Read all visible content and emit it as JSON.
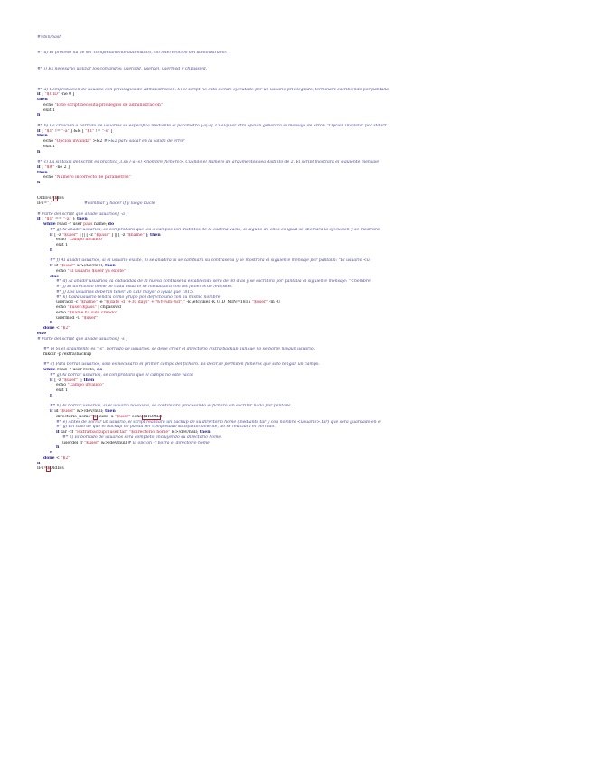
{
  "lines": [
    {
      "i": 0,
      "segs": [
        {
          "c": "cm",
          "t": "#!/bin/bash"
        }
      ]
    },
    {
      "i": 0,
      "segs": []
    },
    {
      "i": 0,
      "segs": []
    },
    {
      "i": 0,
      "segs": [
        {
          "c": "cm",
          "t": "#* a) El proceso ha de ser completamente automático, sin intervención del administrador."
        }
      ]
    },
    {
      "i": 0,
      "segs": []
    },
    {
      "i": 0,
      "segs": []
    },
    {
      "i": 0,
      "segs": [
        {
          "c": "cm",
          "t": "#* i) Es necesario utilizar los comandos: useradd, userdel, usermod y chpasswd."
        }
      ]
    },
    {
      "i": 0,
      "segs": []
    },
    {
      "i": 0,
      "segs": []
    },
    {
      "i": 0,
      "segs": []
    },
    {
      "i": 0,
      "segs": [
        {
          "c": "cm",
          "t": "#* a) Comprobación de usuario con privilegios de administración. Si el script no está siendo ejecutado por un usuario privilegiado, terminará escribiendo por pantalla"
        }
      ]
    },
    {
      "i": 0,
      "segs": [
        {
          "c": "kw",
          "t": "if"
        },
        {
          "c": "pl",
          "t": " [ "
        },
        {
          "c": "st",
          "t": "\"$UID\""
        },
        {
          "c": "pl",
          "t": " -ne 0 ]"
        }
      ]
    },
    {
      "i": 0,
      "segs": [
        {
          "c": "kw",
          "t": "then"
        }
      ]
    },
    {
      "i": 1,
      "segs": [
        {
          "c": "pl",
          "t": "echo "
        },
        {
          "c": "st",
          "t": "\"Este script necesita privilegios de administracion\""
        }
      ]
    },
    {
      "i": 1,
      "segs": [
        {
          "c": "pl",
          "t": "exit 1"
        }
      ]
    },
    {
      "i": 0,
      "segs": [
        {
          "c": "kw",
          "t": "fi"
        }
      ]
    },
    {
      "i": 0,
      "segs": []
    },
    {
      "i": 0,
      "segs": [
        {
          "c": "cm",
          "t": "#* b) La creación o borrado de usuarios se especifica mediante el parámetro [-a|-s]. Cualquier otra opción generará el mensaje de error: \"Opcion invalida\" por stderr"
        }
      ]
    },
    {
      "i": 0,
      "segs": [
        {
          "c": "kw",
          "t": "if"
        },
        {
          "c": "pl",
          "t": " [ "
        },
        {
          "c": "st",
          "t": "\"$1\""
        },
        {
          "c": "pl",
          "t": " != "
        },
        {
          "c": "st",
          "t": "\"-a\""
        },
        {
          "c": "pl",
          "t": " ] && [ "
        },
        {
          "c": "st",
          "t": "\"$1\""
        },
        {
          "c": "pl",
          "t": " != "
        },
        {
          "c": "st",
          "t": "\"-s\""
        },
        {
          "c": "pl",
          "t": " ]"
        }
      ]
    },
    {
      "i": 0,
      "segs": [
        {
          "c": "kw",
          "t": "then"
        }
      ]
    },
    {
      "i": 1,
      "segs": [
        {
          "c": "pl",
          "t": "echo "
        },
        {
          "c": "st",
          "t": "\"Opcion invalida\""
        },
        {
          "c": "pl",
          "t": " >&2 "
        },
        {
          "c": "cm",
          "t": "#>&2 para sacar en la salida de error"
        }
      ]
    },
    {
      "i": 1,
      "segs": [
        {
          "c": "pl",
          "t": "exit 1"
        }
      ]
    },
    {
      "i": 0,
      "segs": [
        {
          "c": "kw",
          "t": "fi"
        }
      ]
    },
    {
      "i": 0,
      "segs": []
    },
    {
      "i": 0,
      "segs": [
        {
          "c": "cm",
          "t": "#* c) La sintaxis del script es practica_3.sh [-a|-s] <nombre_fichero>. Cuando el número de argumentos sea distinto de 2. El script mostrará el siguiente mensaje"
        }
      ]
    },
    {
      "i": 0,
      "segs": [
        {
          "c": "kw",
          "t": "if"
        },
        {
          "c": "pl",
          "t": " [ "
        },
        {
          "c": "st",
          "t": "\"$#\""
        },
        {
          "c": "pl",
          "t": " -ne 2 ]"
        }
      ]
    },
    {
      "i": 0,
      "segs": [
        {
          "c": "kw",
          "t": "then"
        }
      ]
    },
    {
      "i": 1,
      "segs": [
        {
          "c": "pl",
          "t": "echo "
        },
        {
          "c": "st",
          "t": "\"Numero incorrecto de parametros\""
        }
      ]
    },
    {
      "i": 0,
      "segs": [
        {
          "c": "kw",
          "t": "fi"
        }
      ]
    },
    {
      "i": 0,
      "segs": []
    },
    {
      "i": 0,
      "segs": []
    },
    {
      "i": 0,
      "segs": [
        {
          "c": "pl",
          "t": "OldIFs="
        },
        {
          "c": "pl box",
          "t": "$"
        },
        {
          "c": "pl",
          "t": "IFs"
        }
      ]
    },
    {
      "i": 0,
      "segs": [
        {
          "c": "pl",
          "t": "IFs="
        },
        {
          "c": "st",
          "t": "\",\""
        },
        {
          "c": "pl",
          "t": "                        "
        },
        {
          "c": "cm",
          "t": "#cambiar y hacer if y luego bucle"
        }
      ]
    },
    {
      "i": 0,
      "segs": []
    },
    {
      "i": 0,
      "segs": [
        {
          "c": "cm",
          "t": "# Parte del script que añade usuarios [ -a ]"
        }
      ]
    },
    {
      "i": 0,
      "segs": [
        {
          "c": "kw",
          "t": "if"
        },
        {
          "c": "pl",
          "t": " [ "
        },
        {
          "c": "st",
          "t": "\"$1\""
        },
        {
          "c": "pl",
          "t": " == "
        },
        {
          "c": "st",
          "t": "\"-a\""
        },
        {
          "c": "pl",
          "t": " ]; "
        },
        {
          "c": "kw",
          "t": "then"
        }
      ]
    },
    {
      "i": 1,
      "segs": [
        {
          "c": "kw",
          "t": "while"
        },
        {
          "c": "pl",
          "t": " read -r user "
        },
        {
          "c": "st",
          "t": "pass"
        },
        {
          "c": "pl",
          "t": " name; "
        },
        {
          "c": "kw",
          "t": "do"
        }
      ]
    },
    {
      "i": 2,
      "segs": [
        {
          "c": "cm",
          "t": "#* g) Al añadir usuarios, se comprobará que los 3 campos son distintos de la cadena vacía, si alguno de ellos es igual se abortará la ejecución y se mostrará"
        }
      ]
    },
    {
      "i": 2,
      "segs": [
        {
          "c": "kw",
          "t": "if"
        },
        {
          "c": "pl",
          "t": " [ -z "
        },
        {
          "c": "st",
          "t": "\"$user\""
        },
        {
          "c": "pl",
          "t": " ] || [ -z "
        },
        {
          "c": "st",
          "t": "\"$pass\""
        },
        {
          "c": "pl",
          "t": " ] || [ -z "
        },
        {
          "c": "st",
          "t": "\"$name\""
        },
        {
          "c": "pl",
          "t": " ]; "
        },
        {
          "c": "kw",
          "t": "then"
        }
      ]
    },
    {
      "i": 3,
      "segs": [
        {
          "c": "pl",
          "t": "echo "
        },
        {
          "c": "st",
          "t": "\"Campo invalido\""
        }
      ]
    },
    {
      "i": 3,
      "segs": [
        {
          "c": "pl",
          "t": "exit 1"
        }
      ]
    },
    {
      "i": 2,
      "segs": [
        {
          "c": "kw",
          "t": "fi"
        }
      ]
    },
    {
      "i": 0,
      "segs": []
    },
    {
      "i": 2,
      "segs": [
        {
          "c": "cm",
          "t": "#* f) Al añadir usuarios, si el usuario existe, ni se añadirá ni se cambiará su contraseña y se mostrará el siguiente mensaje por pantalla: \"El usuario <u"
        }
      ]
    },
    {
      "i": 2,
      "segs": [
        {
          "c": "kw",
          "t": "if"
        },
        {
          "c": "pl",
          "t": " id "
        },
        {
          "c": "st",
          "t": "\"$user\""
        },
        {
          "c": "pl",
          "t": " &>/dev/null; "
        },
        {
          "c": "kw",
          "t": "then"
        }
      ]
    },
    {
      "i": 3,
      "segs": [
        {
          "c": "pl",
          "t": "echo "
        },
        {
          "c": "st",
          "t": "\"El usuario $user ya existe\""
        }
      ]
    },
    {
      "i": 2,
      "segs": [
        {
          "c": "kw",
          "t": "else"
        }
      ]
    },
    {
      "i": 3,
      "segs": [
        {
          "c": "cm",
          "t": "#* d) Al añadir usuarios, la caducidad de la nueva contraseña establecida será de 30 días y se escribirá por pantalla el siguiente mensaje: \"<nombre"
        }
      ]
    },
    {
      "i": 3,
      "segs": [
        {
          "c": "cm",
          "t": "#* j) El directorio home de cada usuario se inicializará con los ficheros de /etc/skel."
        }
      ]
    },
    {
      "i": 3,
      "segs": [
        {
          "c": "cm",
          "t": "#* j) Los usuarios deberán tener un UID mayor o igual que 1815."
        }
      ]
    },
    {
      "i": 3,
      "segs": [
        {
          "c": "cm",
          "t": "#* k) Cada usuario tendrá como grupo por defecto uno con su mismo nombre"
        }
      ]
    },
    {
      "i": 3,
      "segs": [
        {
          "c": "pl",
          "t": "useradd -c "
        },
        {
          "c": "st",
          "t": "\"$name\""
        },
        {
          "c": "pl",
          "t": " -e "
        },
        {
          "c": "st",
          "t": "\"$(date -d \"+30 days\" +\"%Y-%m-%d\")\""
        },
        {
          "c": "pl",
          "t": " -k /etc/skel -K UID_MIN=1815 "
        },
        {
          "c": "st",
          "t": "\"$user\""
        },
        {
          "c": "pl",
          "t": " -m -U"
        }
      ]
    },
    {
      "i": 3,
      "segs": [
        {
          "c": "pl",
          "t": "echo "
        },
        {
          "c": "st",
          "t": "\"$user:$pass\""
        },
        {
          "c": "pl",
          "t": " | chpasswd"
        }
      ]
    },
    {
      "i": 3,
      "segs": [
        {
          "c": "pl",
          "t": "echo "
        },
        {
          "c": "st",
          "t": "\"$name ha sido creado\""
        }
      ]
    },
    {
      "i": 3,
      "segs": [
        {
          "c": "pl",
          "t": "usermod -U "
        },
        {
          "c": "st",
          "t": "\"$user\""
        }
      ]
    },
    {
      "i": 2,
      "segs": [
        {
          "c": "kw",
          "t": "fi"
        }
      ]
    },
    {
      "i": 1,
      "segs": [
        {
          "c": "kw",
          "t": "done"
        },
        {
          "c": "pl",
          "t": " < "
        },
        {
          "c": "st",
          "t": "\"$2\""
        }
      ]
    },
    {
      "i": 0,
      "segs": [
        {
          "c": "kw",
          "t": "else"
        }
      ]
    },
    {
      "i": 0,
      "segs": [
        {
          "c": "cm",
          "t": "# Parte del script que añade usuarios [ -s ]"
        }
      ]
    },
    {
      "i": 0,
      "segs": []
    },
    {
      "i": 1,
      "segs": [
        {
          "c": "cm",
          "t": "#* p) Si el argumento es \"-s\", borrado de usuarios, se debe crear el directorio /extra/backup aunque no se borre ningún usuario."
        }
      ]
    },
    {
      "i": 1,
      "segs": [
        {
          "c": "pl",
          "t": "mkdir -p /extra/backup"
        }
      ]
    },
    {
      "i": 0,
      "segs": []
    },
    {
      "i": 1,
      "segs": [
        {
          "c": "cm",
          "t": "#* d) Para borrar usuarios, sólo es necesario el primer campo del fichero. Es decir,se permiten ficheros que sólo tengan un campo."
        }
      ]
    },
    {
      "i": 1,
      "segs": [
        {
          "c": "kw",
          "t": "while"
        },
        {
          "c": "pl",
          "t": " read -r user resto; "
        },
        {
          "c": "kw",
          "t": "do"
        }
      ]
    },
    {
      "i": 2,
      "segs": [
        {
          "c": "cm",
          "t": "#* g) Al borrar usuarios, se comprobará que el campo no esté vacío"
        }
      ]
    },
    {
      "i": 2,
      "segs": [
        {
          "c": "kw",
          "t": "if"
        },
        {
          "c": "pl",
          "t": " [ -z "
        },
        {
          "c": "st",
          "t": "\"$user\""
        },
        {
          "c": "pl",
          "t": " ]; "
        },
        {
          "c": "kw",
          "t": "then"
        }
      ]
    },
    {
      "i": 3,
      "segs": [
        {
          "c": "pl",
          "t": "echo "
        },
        {
          "c": "st",
          "t": "\"Campo invalido\""
        }
      ]
    },
    {
      "i": 3,
      "segs": [
        {
          "c": "pl",
          "t": "exit 1"
        }
      ]
    },
    {
      "i": 2,
      "segs": [
        {
          "c": "kw",
          "t": "fi"
        }
      ]
    },
    {
      "i": 0,
      "segs": []
    },
    {
      "i": 2,
      "segs": [
        {
          "c": "cm",
          "t": "#* h) Al borrar usuarios, si el usuario no existe, se continuará procesando el fichero sin escribir nada por pantalla."
        }
      ]
    },
    {
      "i": 2,
      "segs": [
        {
          "c": "kw",
          "t": "if"
        },
        {
          "c": "pl",
          "t": " id "
        },
        {
          "c": "st",
          "t": "\"$user\""
        },
        {
          "c": "pl",
          "t": " &>/dev/null; "
        },
        {
          "c": "kw",
          "t": "then"
        }
      ]
    },
    {
      "i": 3,
      "segs": [
        {
          "c": "pl",
          "t": "directorio_home="
        },
        {
          "c": "pl box",
          "t": "$"
        },
        {
          "c": "pl",
          "t": "(sudo -u "
        },
        {
          "c": "st",
          "t": "\"$user\""
        },
        {
          "c": "pl",
          "t": " echo "
        },
        {
          "c": "pl box",
          "t": "$HOME"
        },
        {
          "c": "pl",
          "t": ")"
        }
      ]
    },
    {
      "i": 3,
      "segs": [
        {
          "c": "cm",
          "t": "#* e) Antes de borrar un usuario, el script realizará un backup de su directorio home (mediante tar y con nombre <usuario>.tar) que será guardado en e"
        }
      ]
    },
    {
      "i": 3,
      "segs": [
        {
          "c": "cm",
          "t": "#* g) En caso de que el backup no pueda ser completado satisfactoriamente, no se realizará el borrado."
        }
      ]
    },
    {
      "i": 3,
      "segs": [
        {
          "c": "kw",
          "t": "if"
        },
        {
          "c": "pl",
          "t": " tar -cf "
        },
        {
          "c": "st",
          "t": "\"/extra/backup/$user.tar\""
        },
        {
          "c": "pl",
          "t": " "
        },
        {
          "c": "st",
          "t": "\"$directorio_home\""
        },
        {
          "c": "pl",
          "t": " &>/dev/null; "
        },
        {
          "c": "kw",
          "t": "then"
        }
      ]
    },
    {
      "i": 4,
      "segs": [
        {
          "c": "cm",
          "t": "#* n) El borrado de usuarios será completo, incluyendo su directorio home."
        }
      ]
    },
    {
      "i": 4,
      "segs": [
        {
          "c": "pl",
          "t": "userdel -r "
        },
        {
          "c": "st",
          "t": "\"$user\""
        },
        {
          "c": "pl",
          "t": " &>/dev/null "
        },
        {
          "c": "cm",
          "t": "# la opcion -r borra el directorio home"
        }
      ]
    },
    {
      "i": 3,
      "segs": [
        {
          "c": "kw",
          "t": "fi"
        }
      ]
    },
    {
      "i": 2,
      "segs": [
        {
          "c": "kw",
          "t": "fi"
        }
      ]
    },
    {
      "i": 1,
      "segs": [
        {
          "c": "kw",
          "t": "done"
        },
        {
          "c": "pl",
          "t": " < "
        },
        {
          "c": "st",
          "t": "\"$2\""
        }
      ]
    },
    {
      "i": 0,
      "segs": [
        {
          "c": "kw",
          "t": "fi"
        }
      ]
    },
    {
      "i": 0,
      "segs": [
        {
          "c": "pl",
          "t": "IFs="
        },
        {
          "c": "pl box",
          "t": "$"
        },
        {
          "c": "pl",
          "t": "OldIFs"
        }
      ]
    }
  ]
}
